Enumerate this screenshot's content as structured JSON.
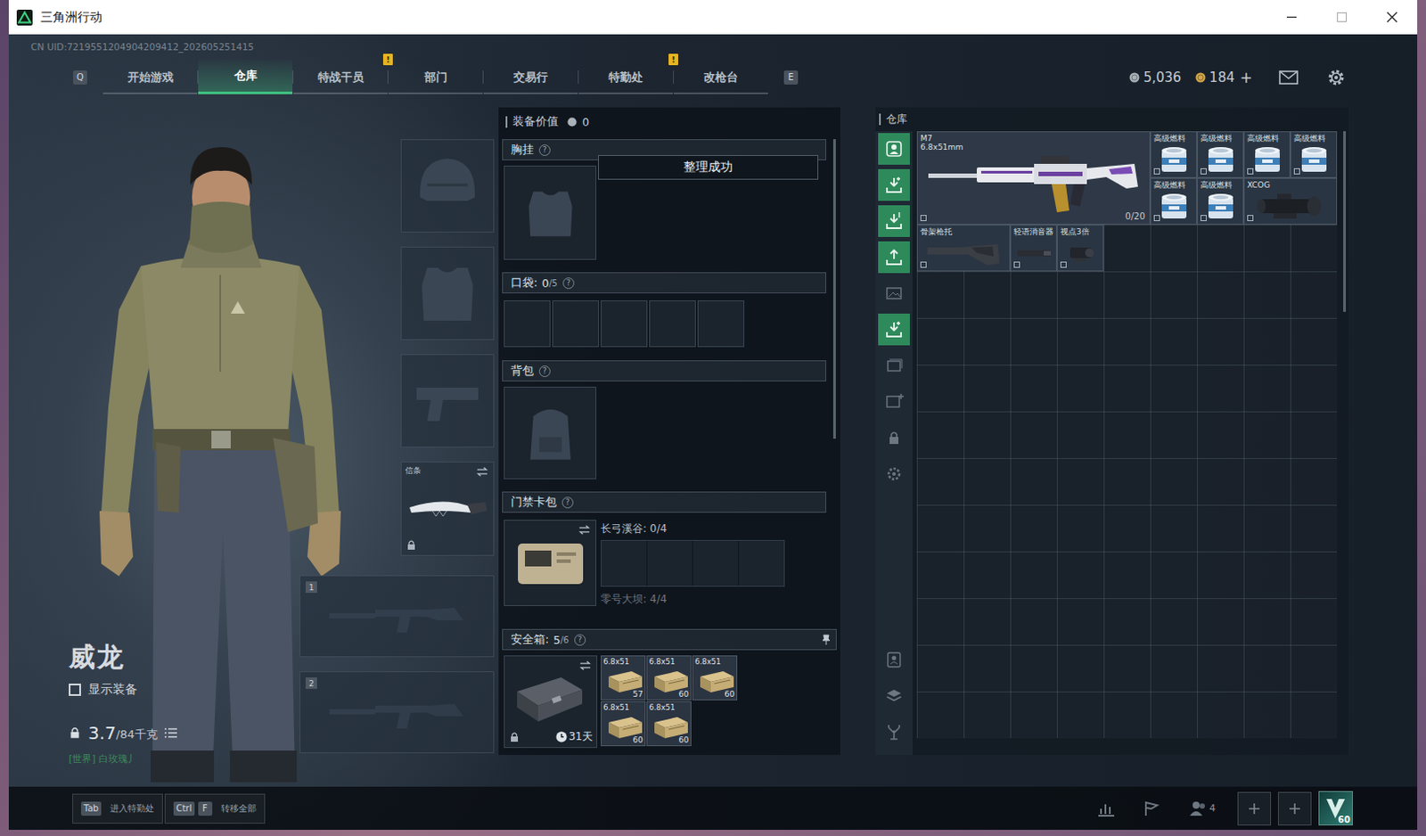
{
  "window": {
    "title": "三角洲行动"
  },
  "uid": "CN UID:7219551204904209412_202605251415",
  "nav": {
    "prev_key": "Q",
    "next_key": "E",
    "alert_mark": "!",
    "tabs": [
      {
        "label": "开始游戏",
        "selected": false,
        "alert": false
      },
      {
        "label": "仓库",
        "selected": true,
        "alert": false
      },
      {
        "label": "特战干员",
        "selected": false,
        "alert": true
      },
      {
        "label": "部门",
        "selected": false,
        "alert": false
      },
      {
        "label": "交易行",
        "selected": false,
        "alert": false
      },
      {
        "label": "特勤处",
        "selected": false,
        "alert": true
      },
      {
        "label": "改枪台",
        "selected": false,
        "alert": false
      }
    ]
  },
  "wallet": {
    "coins": [
      {
        "amount": "5,036",
        "color": "#a9b1b9"
      },
      {
        "amount": "184",
        "color": "#d2a64a"
      }
    ],
    "top_up": "+"
  },
  "character": {
    "name": "威龙",
    "show_gear": {
      "label": "显示装备",
      "checked": false
    },
    "weight": {
      "current": "3.7",
      "limit": "/84千克"
    },
    "chat": "[世界] 白玫瑰丿"
  },
  "gear_slots": [
    {
      "kind": "helmet",
      "filled": false
    },
    {
      "kind": "armor",
      "filled": false
    },
    {
      "kind": "pistol",
      "filled": false
    }
  ],
  "melee": {
    "label": "信条",
    "locked": true
  },
  "weapon_slots": [
    {
      "number": "1",
      "filled": false
    },
    {
      "number": "2",
      "filled": false
    }
  ],
  "loadout": {
    "value_label": "装备价值",
    "value": "0",
    "toast": "整理成功",
    "chest_rig": {
      "title": "胸挂",
      "help": "?",
      "filled": false
    },
    "pocket": {
      "title": "口袋:",
      "used": "0",
      "capacity": "/5",
      "help": "?",
      "slots": [
        {
          "filled": false
        },
        {
          "filled": false
        },
        {
          "filled": false
        },
        {
          "filled": false
        },
        {
          "filled": false
        }
      ]
    },
    "backpack": {
      "title": "背包",
      "help": "?",
      "filled": false
    },
    "keycard": {
      "title": "门禁卡包",
      "help": "?",
      "maps": [
        {
          "label": "长弓溪谷: 0/4",
          "dim": false,
          "slots": [
            {
              "filled": false
            },
            {
              "filled": false
            },
            {
              "filled": false
            },
            {
              "filled": false
            }
          ]
        },
        {
          "label": "零号大坝: 4/4",
          "dim": true,
          "slots": []
        }
      ]
    },
    "safe_box": {
      "title": "安全箱:",
      "used": "5",
      "capacity": "/6",
      "help": "?",
      "locked": true,
      "days": "31天",
      "items": [
        {
          "label": "6.8x51",
          "count": "57"
        },
        {
          "label": "6.8x51",
          "count": "60"
        },
        {
          "label": "6.8x51",
          "count": "60"
        },
        {
          "label": "6.8x51",
          "count": "60"
        },
        {
          "label": "6.8x51",
          "count": "60"
        }
      ]
    }
  },
  "warehouse": {
    "title": "仓库",
    "tools_top": [
      {
        "highlighted": true
      },
      {
        "highlighted": true
      },
      {
        "highlighted": true
      },
      {
        "highlighted": true
      },
      {
        "highlighted": false
      },
      {
        "highlighted": true
      },
      {
        "highlighted": false
      },
      {
        "highlighted": false
      },
      {
        "highlighted": false
      },
      {
        "highlighted": false
      }
    ],
    "tools_bottom": [
      {
        "highlighted": false
      },
      {
        "highlighted": false
      },
      {
        "highlighted": false
      }
    ],
    "items": [
      {
        "kind": "rifle",
        "name": "M7",
        "caliber": "6.8x51mm",
        "ammo": "0/20"
      },
      {
        "kind": "fuel",
        "name": "高级燃料"
      },
      {
        "kind": "fuel",
        "name": "高级燃料"
      },
      {
        "kind": "fuel",
        "name": "高级燃料"
      },
      {
        "kind": "fuel",
        "name": "高级燃料"
      },
      {
        "kind": "fuel",
        "name": "高级燃料"
      },
      {
        "kind": "fuel",
        "name": "高级燃料"
      },
      {
        "kind": "scope",
        "name": "XCOG"
      },
      {
        "kind": "stock",
        "name": "骨架枪托"
      },
      {
        "kind": "suppressor",
        "name": "轻语消音器"
      },
      {
        "kind": "sight",
        "name": "视点3倍"
      }
    ]
  },
  "bottom_bar": {
    "hints": [
      {
        "keys": [
          "Tab"
        ],
        "label": "进入特勤处"
      },
      {
        "keys": [
          "Ctrl",
          "F"
        ],
        "label": "转移全部"
      }
    ],
    "squad": "4",
    "level": "60"
  }
}
